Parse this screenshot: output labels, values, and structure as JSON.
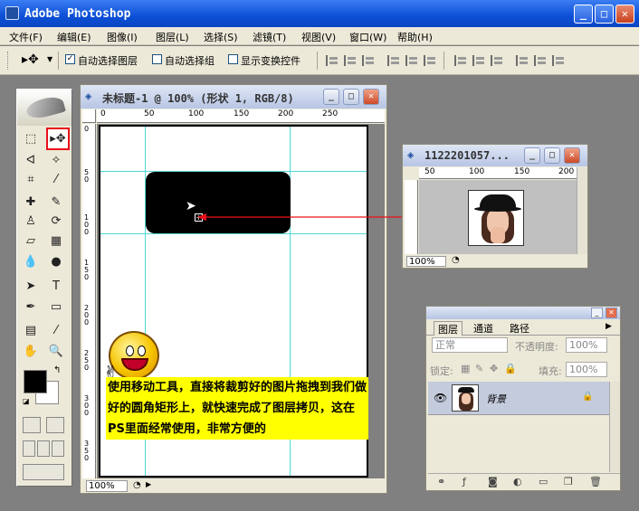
{
  "app": {
    "title": "Adobe Photoshop"
  },
  "window_buttons": {
    "minimize": "_",
    "maximize": "□",
    "close": "✕"
  },
  "menu": [
    "文件(F)",
    "编辑(E)",
    "图像(I)",
    "图层(L)",
    "选择(S)",
    "滤镜(T)",
    "视图(V)",
    "窗口(W)",
    "帮助(H)"
  ],
  "options": {
    "auto_select_layer": {
      "label": "自动选择图层",
      "checked": true
    },
    "auto_select_group": {
      "label": "自动选择组",
      "checked": false
    },
    "show_transform": {
      "label": "显示变换控件",
      "checked": false
    }
  },
  "document": {
    "title": "未标题-1 @ 100% (形状 1, RGB/8)",
    "zoom": "100%",
    "ruler_top": [
      "0",
      "50",
      "100",
      "150",
      "200",
      "250"
    ],
    "ruler_left": [
      "0",
      "5 0",
      "1 0 0",
      "1 5 0",
      "2 0 0",
      "2 5 0",
      "3 0 0",
      "3 5 0"
    ]
  },
  "source": {
    "title": "1122201057...",
    "zoom": "100%",
    "ruler_top": [
      "50",
      "100",
      "150",
      "200"
    ]
  },
  "note": {
    "text": "使用移动工具，直接将裁剪好的图片拖拽到我们做好的圆角矩形上，就快速完成了图层拷贝，这在PS里面经常使用，非常方便的"
  },
  "layers_panel": {
    "tabs": [
      "图层",
      "通道",
      "路径"
    ],
    "blend_mode": "正常",
    "opacity_label": "不透明度:",
    "opacity_value": "100%",
    "lock_label": "锁定:",
    "fill_label": "填充:",
    "fill_value": "100%",
    "layer_name": "背景"
  },
  "colors": {
    "accent": "#e8101a",
    "guide": "#4fd7d7",
    "note_bg": "#ffff00"
  }
}
